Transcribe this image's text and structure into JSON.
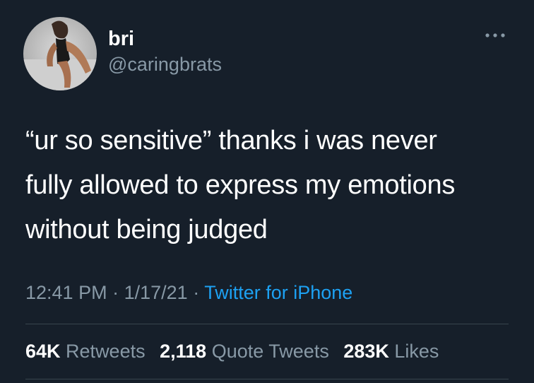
{
  "tweet": {
    "user": {
      "name": "bri",
      "handle": "@caringbrats",
      "avatar_icon": "profile-photo"
    },
    "more_icon": "more-options-icon",
    "text_lines": [
      "“ur so sensitive” thanks i was never",
      "fully allowed to express my emotions",
      "without being judged"
    ],
    "time": "12:41 PM",
    "date": "1/17/21",
    "separator": "·",
    "source": "Twitter for iPhone",
    "stats": {
      "retweets_count": "64K",
      "retweets_label": "Retweets",
      "quote_count": "2,118",
      "quote_label": "Quote Tweets",
      "likes_count": "283K",
      "likes_label": "Likes"
    }
  },
  "colors": {
    "background": "#161f2a",
    "primary_text": "#ffffff",
    "secondary_text": "#8899a6",
    "accent": "#1da1f2",
    "divider": "#38444d"
  }
}
